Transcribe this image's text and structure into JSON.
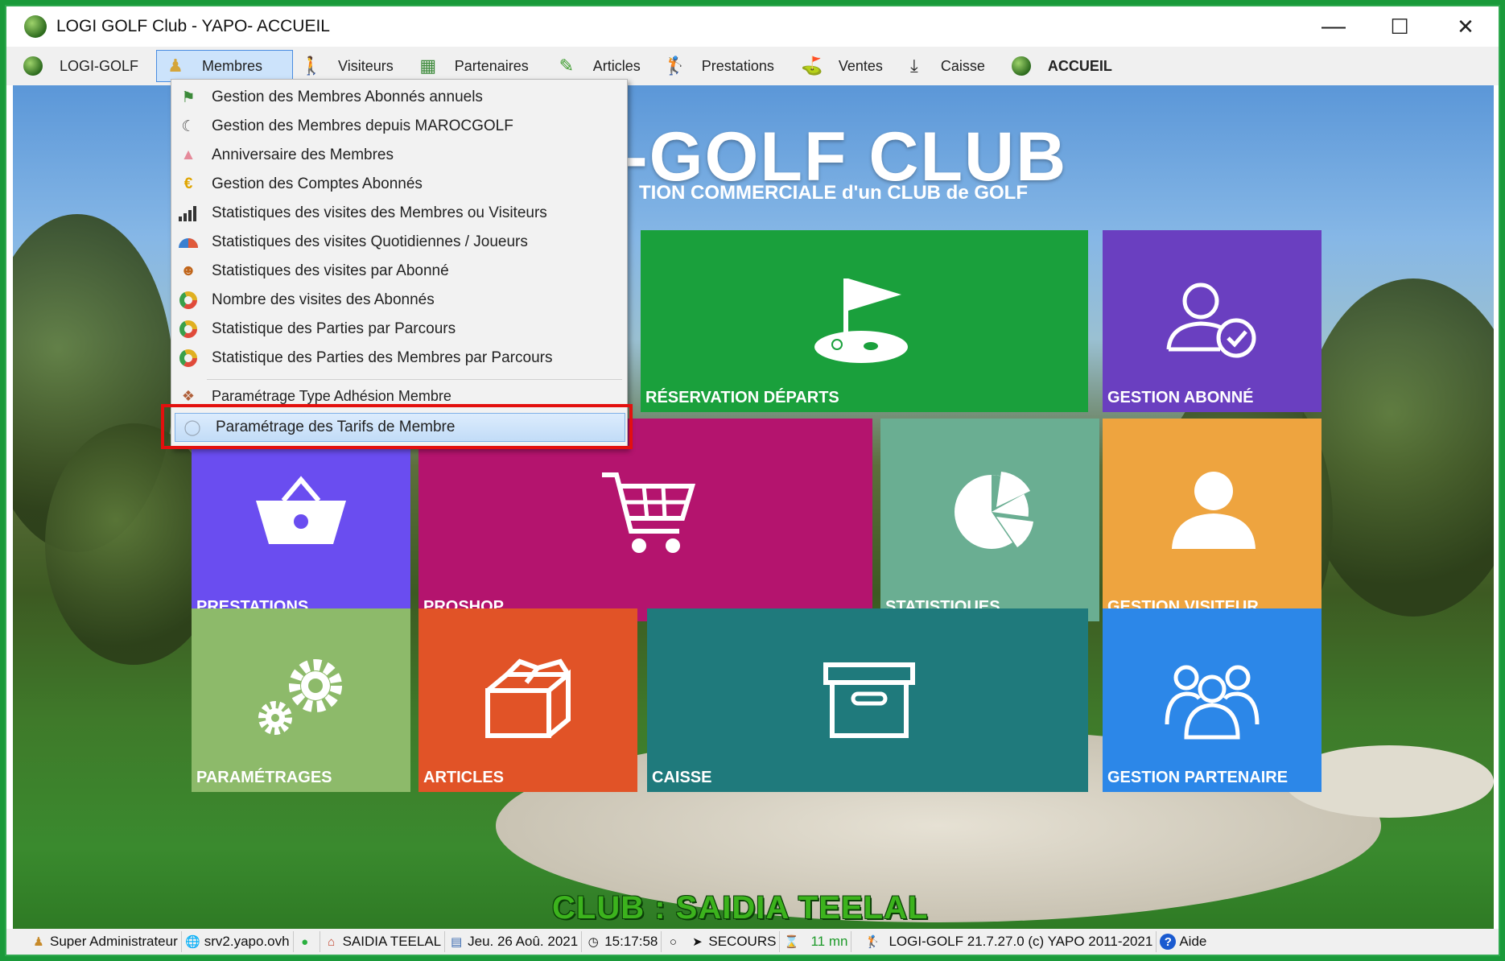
{
  "window": {
    "title": "LOGI GOLF Club - YAPO- ACCUEIL"
  },
  "menubar": [
    {
      "label": "LOGI-GOLF",
      "icon": "golf-ball-icon"
    },
    {
      "label": "Membres",
      "icon": "member-icon",
      "active": true
    },
    {
      "label": "Visiteurs",
      "icon": "walker-icon"
    },
    {
      "label": "Partenaires",
      "icon": "partners-icon"
    },
    {
      "label": "Articles",
      "icon": "pencil-icon"
    },
    {
      "label": "Prestations",
      "icon": "golfer-icon"
    },
    {
      "label": "Ventes",
      "icon": "sales-icon"
    },
    {
      "label": "Caisse",
      "icon": "download-icon"
    },
    {
      "label": "ACCUEIL",
      "icon": "golf-ball-icon"
    }
  ],
  "dropdown": {
    "items": [
      "Gestion des Membres Abonnés annuels",
      "Gestion des Membres depuis MAROCGOLF",
      "Anniversaire des Membres",
      "Gestion des Comptes Abonnés",
      "Statistiques des visites des Membres ou Visiteurs",
      "Statistiques des visites Quotidiennes / Joueurs",
      "Statistiques des visites par Abonné",
      "Nombre des visites des Abonnés",
      "Statistique des Parties par Parcours",
      "Statistique des Parties des Membres  par Parcours",
      "Paramétrage Type Adhésion Membre",
      "Paramétrage des Tarifs de Membre"
    ]
  },
  "brand": {
    "title": "-GOLF CLUB",
    "subtitle": "TION COMMERCIALE d'un CLUB de GOLF"
  },
  "tiles": {
    "reservation": "RÉSERVATION DÉPARTS",
    "abonne": "GESTION ABONNÉ",
    "prestations": "PRESTATIONS",
    "proshop": "PROSHOP",
    "statistiques": "STATISTIQUES",
    "visiteur": "GESTION VISITEUR",
    "parametrages": "PARAMÉTRAGES",
    "articles": "ARTICLES",
    "caisse": "CAISSE",
    "partenaire": "GESTION PARTENAIRE"
  },
  "tile_colors": {
    "reservation": "#1aa03c",
    "abonne": "#6a3fc0",
    "prestations": "#6a4df0",
    "proshop": "#b4146e",
    "statistiques": "#6aae92",
    "visiteur": "#eea43f",
    "parametrages": "#8dba6a",
    "articles": "#e15327",
    "caisse": "#1f7a7c",
    "partenaire": "#2c87e8"
  },
  "club": "CLUB : SAIDIA TEELAL",
  "status": {
    "user": "Super Administrateur",
    "server": "srv2.yapo.ovh",
    "club": "SAIDIA TEELAL",
    "date": "Jeu. 26 Aoû. 2021",
    "time": "15:17:58",
    "backup": "SECOURS",
    "timer": "11 mn",
    "version": "LOGI-GOLF 21.7.27.0  (c) YAPO 2011-2021",
    "help": "Aide"
  }
}
